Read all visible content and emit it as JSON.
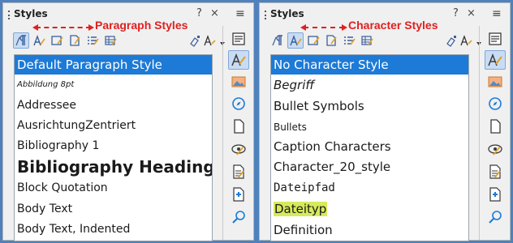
{
  "annotations": {
    "paragraph_label": "Paragraph Styles",
    "character_label": "Character Styles",
    "color": "#e02020"
  },
  "panels": [
    {
      "title": "Styles",
      "help": "?",
      "close": "×",
      "menu": "≡",
      "toolbar_icons": [
        "paragraph-styles-icon",
        "character-styles-icon",
        "frame-styles-icon",
        "page-styles-icon",
        "list-styles-icon",
        "table-styles-icon"
      ],
      "active_toolbar_icon": 0,
      "items": [
        {
          "label": "Default Paragraph Style",
          "selected": true
        },
        {
          "label": "Abbildung 8pt"
        },
        {
          "label": "Addressee"
        },
        {
          "label": "AusrichtungZentriert"
        },
        {
          "label": "Bibliography 1"
        },
        {
          "label": "Bibliography Heading"
        },
        {
          "label": "Block Quotation"
        },
        {
          "label": "Body Text"
        },
        {
          "label": "Body Text, Indented"
        }
      ]
    },
    {
      "title": "Styles",
      "help": "?",
      "close": "×",
      "menu": "≡",
      "toolbar_icons": [
        "paragraph-styles-icon",
        "character-styles-icon",
        "frame-styles-icon",
        "page-styles-icon",
        "list-styles-icon",
        "table-styles-icon"
      ],
      "active_toolbar_icon": 1,
      "items": [
        {
          "label": "No Character Style",
          "selected": true
        },
        {
          "label": "Begriff"
        },
        {
          "label": "Bullet Symbols"
        },
        {
          "label": "Bullets"
        },
        {
          "label": "Caption Characters"
        },
        {
          "label": "Character_20_style"
        },
        {
          "label": "Dateipfad"
        },
        {
          "label": "Dateityp",
          "highlight": "#d7ea5b"
        },
        {
          "label": "Definition"
        }
      ]
    }
  ],
  "sidebar_icons": [
    "properties-icon",
    "styles-icon",
    "gallery-icon",
    "navigator-icon",
    "page-icon",
    "style-inspector-icon",
    "manage-changes-icon",
    "design-icon",
    "find-icon"
  ],
  "colors": {
    "selection": "#1d7ad6",
    "background": "#4f81bd",
    "panel": "#f0f0f0"
  }
}
